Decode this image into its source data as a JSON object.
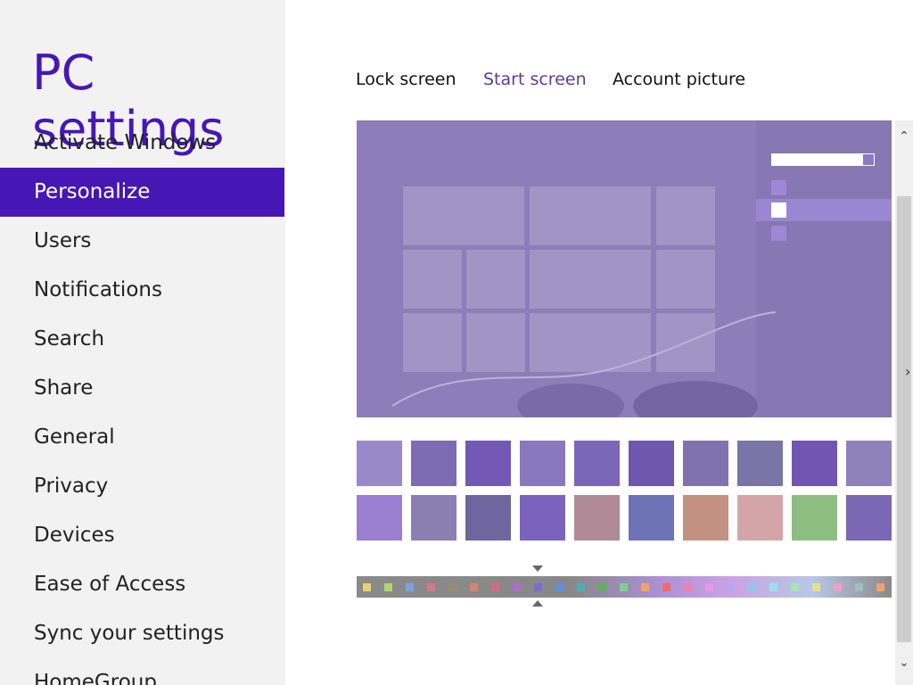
{
  "app": {
    "title": "PC settings"
  },
  "nav": {
    "items": [
      {
        "label": "Activate Windows"
      },
      {
        "label": "Personalize"
      },
      {
        "label": "Users"
      },
      {
        "label": "Notifications"
      },
      {
        "label": "Search"
      },
      {
        "label": "Share"
      },
      {
        "label": "General"
      },
      {
        "label": "Privacy"
      },
      {
        "label": "Devices"
      },
      {
        "label": "Ease of Access"
      },
      {
        "label": "Sync your settings"
      },
      {
        "label": "HomeGroup"
      }
    ],
    "selected": "Personalize"
  },
  "tabs": {
    "items": [
      {
        "label": "Lock screen"
      },
      {
        "label": "Start screen"
      },
      {
        "label": "Account picture"
      }
    ],
    "active": "Start screen"
  },
  "colors": {
    "accent": "#4617b4",
    "background": "#f2f2f2",
    "preview": "#8d7db8"
  },
  "background_patterns": {
    "count": 20,
    "selected_index": 0
  },
  "color_palette": {
    "swatch_count": 25
  },
  "icons": [
    "scroll-up-arrow-icon",
    "scroll-down-arrow-icon",
    "mouse-cursor-icon",
    "palette-marker-icon"
  ]
}
